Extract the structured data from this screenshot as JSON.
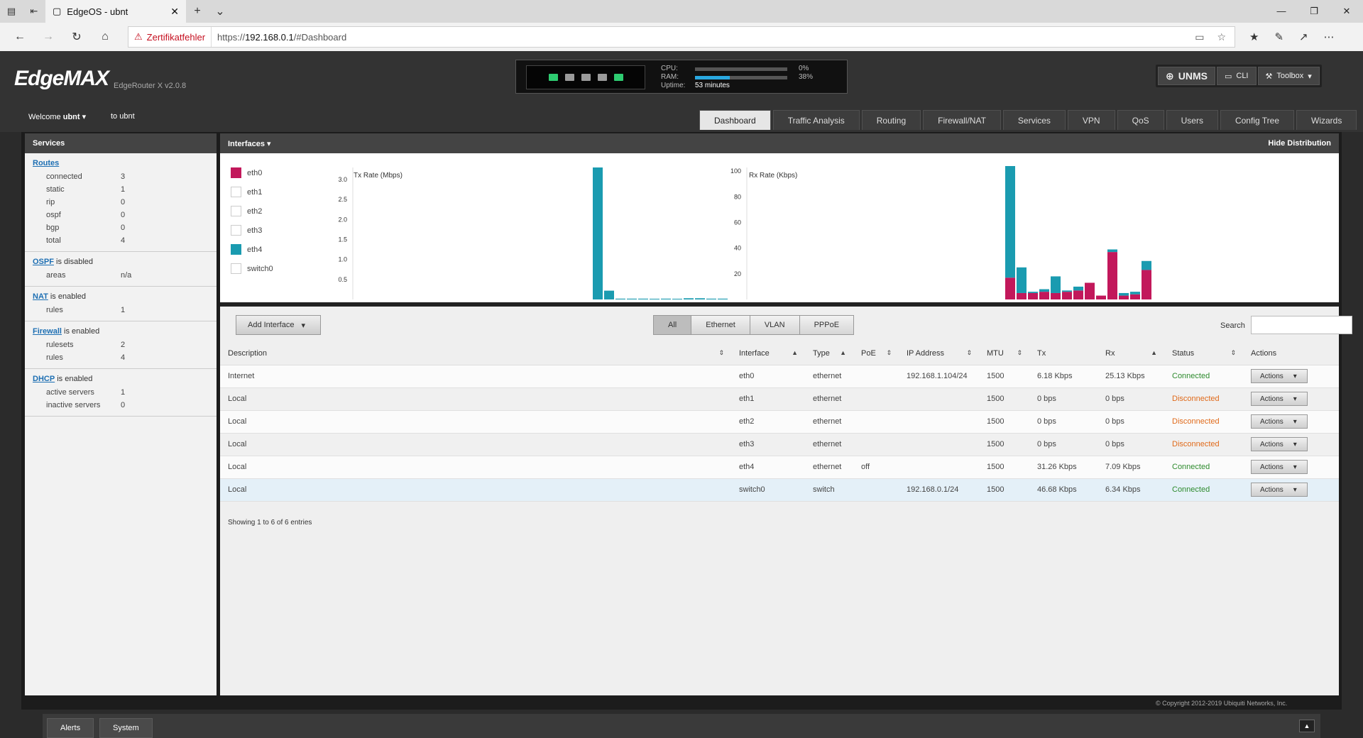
{
  "browser": {
    "tab_title": "EdgeOS - ubnt",
    "cert_warning": "Zertifikatfehler",
    "url_prefix": "https://",
    "url_host": "192.168.0.1",
    "url_path": "/#Dashboard"
  },
  "header": {
    "logo": "EdgeMAX",
    "model": "EdgeRouter X v2.0.8",
    "cpu_label": "CPU:",
    "cpu_pct": "0%",
    "cpu_value": 0,
    "ram_label": "RAM:",
    "ram_pct": "38%",
    "ram_value": 38,
    "uptime_label": "Uptime:",
    "uptime": "53 minutes",
    "port_colors": [
      "#2ecc71",
      "#9a9a9a",
      "#9a9a9a",
      "#9a9a9a",
      "#2ecc71"
    ],
    "unms_label": "UNMS",
    "cli_label": "CLI",
    "toolbox_label": "Toolbox"
  },
  "user": {
    "welcome": "Welcome",
    "name": "ubnt",
    "to": "to ubnt"
  },
  "nav_tabs": [
    "Dashboard",
    "Traffic Analysis",
    "Routing",
    "Firewall/NAT",
    "Services",
    "VPN",
    "QoS",
    "Users",
    "Config Tree",
    "Wizards"
  ],
  "sidebar": {
    "title": "Services",
    "routes": {
      "title": "Routes",
      "rows": [
        [
          "connected",
          "3"
        ],
        [
          "static",
          "1"
        ],
        [
          "rip",
          "0"
        ],
        [
          "ospf",
          "0"
        ],
        [
          "bgp",
          "0"
        ],
        [
          "total",
          "4"
        ]
      ]
    },
    "ospf": {
      "link": "OSPF",
      "status": "is disabled",
      "rows": [
        [
          "areas",
          "n/a"
        ]
      ]
    },
    "nat": {
      "link": "NAT",
      "status": "is enabled",
      "rows": [
        [
          "rules",
          "1"
        ]
      ]
    },
    "firewall": {
      "link": "Firewall",
      "status": "is enabled",
      "rows": [
        [
          "rulesets",
          "2"
        ],
        [
          "rules",
          "4"
        ]
      ]
    },
    "dhcp": {
      "link": "DHCP",
      "status": "is enabled",
      "rows": [
        [
          "active servers",
          "1"
        ],
        [
          "inactive servers",
          "0"
        ]
      ]
    }
  },
  "interfaces_panel": {
    "title": "Interfaces",
    "hide": "Hide Distribution",
    "legend": [
      {
        "name": "eth0",
        "color": "#c2185b"
      },
      {
        "name": "eth1",
        "color": "#ffffff"
      },
      {
        "name": "eth2",
        "color": "#ffffff"
      },
      {
        "name": "eth3",
        "color": "#ffffff"
      },
      {
        "name": "eth4",
        "color": "#1a9bb0"
      },
      {
        "name": "switch0",
        "color": "#ffffff"
      }
    ]
  },
  "chart_data": [
    {
      "type": "bar",
      "title": "Tx Rate (Mbps)",
      "yticks": [
        3.0,
        2.5,
        2.0,
        1.5,
        1.0,
        0.5
      ],
      "ylim": [
        0,
        3.3
      ],
      "series": [
        {
          "name": "eth4",
          "color": "#1a9bb0",
          "values": [
            3.3,
            0.22,
            0.02,
            0.02,
            0.02,
            0.01,
            0.02,
            0.01,
            0.03,
            0.03,
            0.02,
            0.02
          ]
        },
        {
          "name": "eth0",
          "color": "#c2185b",
          "values": [
            0,
            0,
            0,
            0,
            0,
            0,
            0,
            0,
            0,
            0,
            0,
            0
          ]
        }
      ]
    },
    {
      "type": "bar",
      "title": "Rx Rate (Kbps)",
      "yticks": [
        100,
        80,
        60,
        40,
        20
      ],
      "ylim": [
        0,
        104
      ],
      "series": [
        {
          "name": "eth0",
          "color": "#c2185b",
          "values": [
            17,
            5,
            5,
            6,
            5,
            6,
            7,
            13,
            3,
            37,
            3,
            4,
            23
          ]
        },
        {
          "name": "eth4",
          "color": "#1a9bb0",
          "values": [
            87,
            20,
            1,
            2,
            13,
            1,
            3,
            0,
            0,
            2,
            2,
            2,
            7
          ]
        }
      ]
    }
  ],
  "toolbar": {
    "add_label": "Add Interface",
    "filters": [
      "All",
      "Ethernet",
      "VLAN",
      "PPPoE"
    ],
    "search_label": "Search"
  },
  "table": {
    "headers": [
      "Description",
      "Interface",
      "Type",
      "PoE",
      "IP Address",
      "MTU",
      "Tx",
      "Rx",
      "Status",
      "Actions"
    ],
    "rows": [
      {
        "desc": "Internet",
        "iface": "eth0",
        "type": "ethernet",
        "poe": "",
        "ip": "192.168.1.104/24",
        "mtu": "1500",
        "tx": "6.18 Kbps",
        "rx": "25.13 Kbps",
        "status": "Connected",
        "ok": true
      },
      {
        "desc": "Local",
        "iface": "eth1",
        "type": "ethernet",
        "poe": "",
        "ip": "",
        "mtu": "1500",
        "tx": "0 bps",
        "rx": "0 bps",
        "status": "Disconnected",
        "ok": false
      },
      {
        "desc": "Local",
        "iface": "eth2",
        "type": "ethernet",
        "poe": "",
        "ip": "",
        "mtu": "1500",
        "tx": "0 bps",
        "rx": "0 bps",
        "status": "Disconnected",
        "ok": false
      },
      {
        "desc": "Local",
        "iface": "eth3",
        "type": "ethernet",
        "poe": "",
        "ip": "",
        "mtu": "1500",
        "tx": "0 bps",
        "rx": "0 bps",
        "status": "Disconnected",
        "ok": false
      },
      {
        "desc": "Local",
        "iface": "eth4",
        "type": "ethernet",
        "poe": "off",
        "ip": "",
        "mtu": "1500",
        "tx": "31.26 Kbps",
        "rx": "7.09 Kbps",
        "status": "Connected",
        "ok": true
      },
      {
        "desc": "Local",
        "iface": "switch0",
        "type": "switch",
        "poe": "",
        "ip": "192.168.0.1/24",
        "mtu": "1500",
        "tx": "46.68 Kbps",
        "rx": "6.34 Kbps",
        "status": "Connected",
        "ok": true
      }
    ],
    "action_label": "Actions",
    "showing": "Showing 1 to 6 of 6 entries"
  },
  "footer": {
    "copyright": "© Copyright 2012-2019 Ubiquiti Networks, Inc.",
    "alerts": "Alerts",
    "system": "System"
  }
}
